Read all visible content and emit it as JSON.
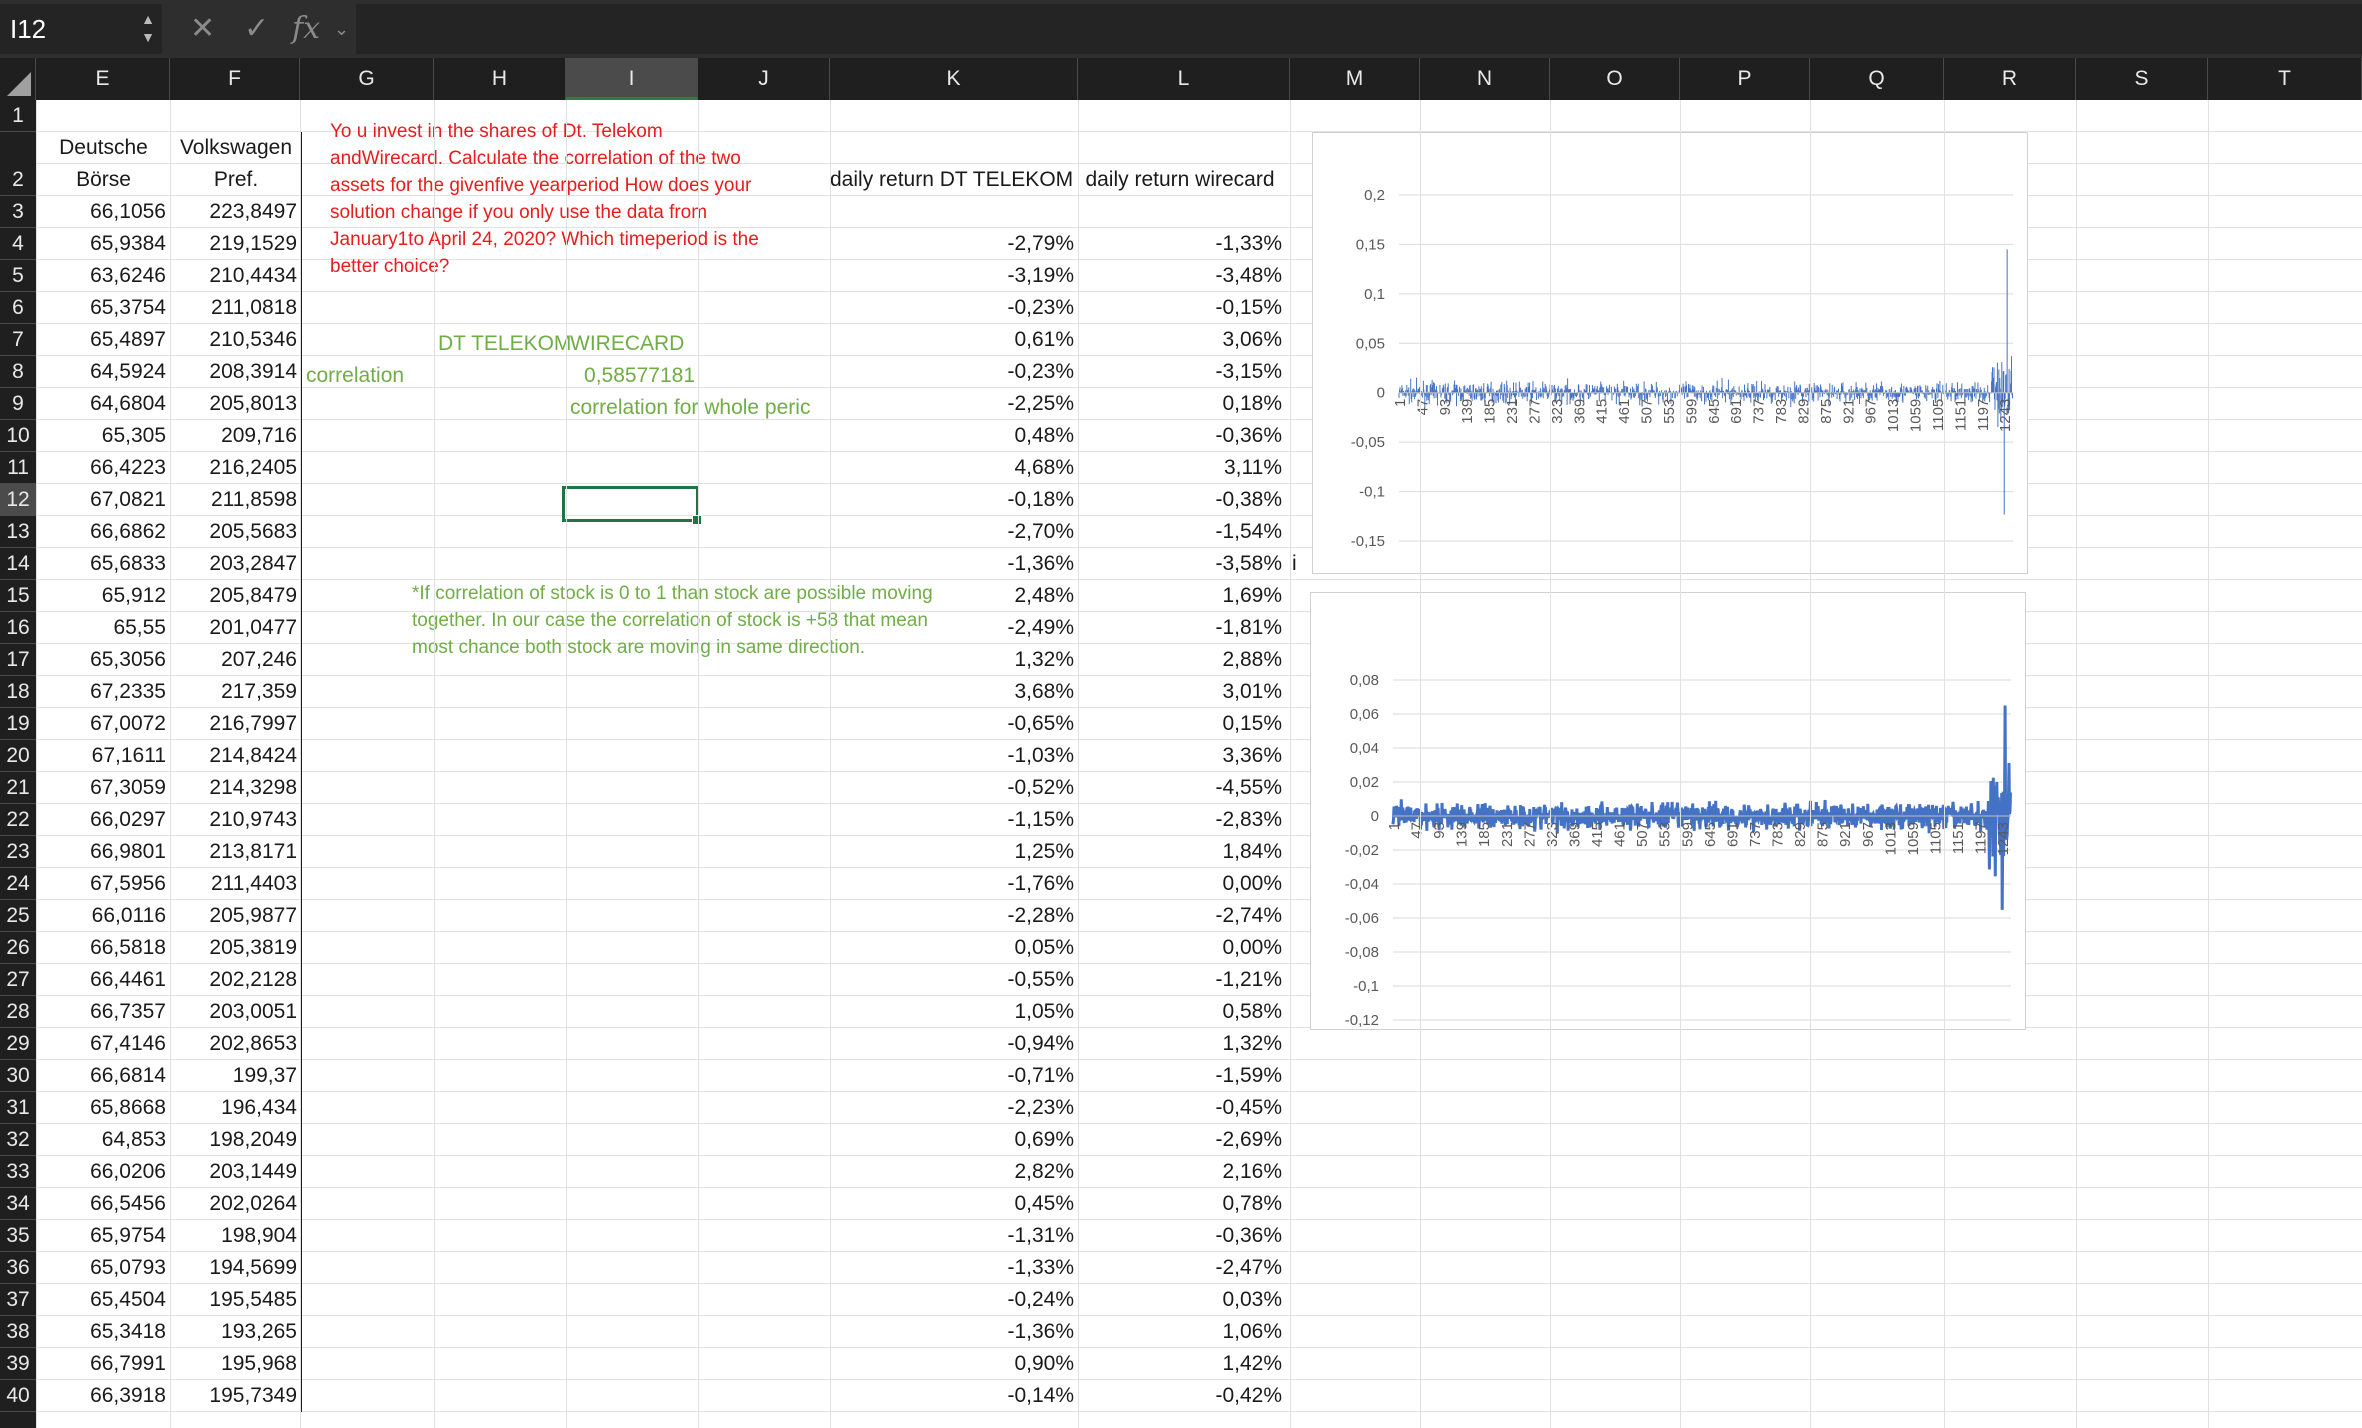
{
  "formula_bar": {
    "name_box": "I12",
    "fx_label": "fx",
    "value": ""
  },
  "columns": [
    "E",
    "F",
    "G",
    "H",
    "I",
    "J",
    "K",
    "L",
    "M",
    "N",
    "O",
    "P",
    "Q",
    "R",
    "S",
    "T"
  ],
  "rows_visible": [
    "1",
    "2",
    "3",
    "4",
    "5",
    "6",
    "7",
    "8",
    "9",
    "10",
    "11",
    "12",
    "13",
    "14",
    "15",
    "16",
    "17",
    "18",
    "19",
    "20",
    "21",
    "22",
    "23",
    "24",
    "25",
    "26",
    "27",
    "28",
    "29",
    "30",
    "31",
    "32",
    "33",
    "34",
    "35",
    "36",
    "37",
    "38",
    "39",
    "40"
  ],
  "selected": {
    "column": "I",
    "row": "12"
  },
  "headers": {
    "deutsche_line1": "Deutsche",
    "deutsche_line2": "Börse",
    "vw_line1": "Volkswagen",
    "vw_line2": "Pref.",
    "daily_telekom": "daily return DT TELEKOM",
    "daily_wirecard": "daily return wirecard"
  },
  "task_text": [
    "Yo u invest in the shares of Dt. Telekom",
    "andWirecard. Calculate the correlation of the two",
    "assets for the givenfive yearperiod How does your",
    "solution change if you only use the data from",
    "January1to April 24, 2020? Which timeperiod is the",
    "better choice?"
  ],
  "corr_labels": {
    "dt": "DT TELEKOM",
    "wc": "WIRECARD",
    "label": "correlation",
    "value": "0,58577181",
    "note": "correlation for whole peric"
  },
  "comment_text": [
    "*If correlation of stock is 0 to 1 than stock are possible moving",
    "together. In our case the correlation  of stock is +58 that mean",
    "most chance both stock are moving in same direction."
  ],
  "stray_char": "i",
  "table_rows": [
    {
      "e": "66,1056",
      "f": "223,8497",
      "k": "",
      "l": ""
    },
    {
      "e": "65,9384",
      "f": "219,1529",
      "k": "-2,79%",
      "l": "-1,33%"
    },
    {
      "e": "63,6246",
      "f": "210,4434",
      "k": "-3,19%",
      "l": "-3,48%"
    },
    {
      "e": "65,3754",
      "f": "211,0818",
      "k": "-0,23%",
      "l": "-0,15%"
    },
    {
      "e": "65,4897",
      "f": "210,5346",
      "k": "0,61%",
      "l": "3,06%"
    },
    {
      "e": "64,5924",
      "f": "208,3914",
      "k": "-0,23%",
      "l": "-3,15%"
    },
    {
      "e": "64,6804",
      "f": "205,8013",
      "k": "-2,25%",
      "l": "0,18%"
    },
    {
      "e": "65,305",
      "f": "209,716",
      "k": "0,48%",
      "l": "-0,36%"
    },
    {
      "e": "66,4223",
      "f": "216,2405",
      "k": "4,68%",
      "l": "3,11%"
    },
    {
      "e": "67,0821",
      "f": "211,8598",
      "k": "-0,18%",
      "l": "-0,38%"
    },
    {
      "e": "66,6862",
      "f": "205,5683",
      "k": "-2,70%",
      "l": "-1,54%"
    },
    {
      "e": "65,6833",
      "f": "203,2847",
      "k": "-1,36%",
      "l": "-3,58%"
    },
    {
      "e": "65,912",
      "f": "205,8479",
      "k": "2,48%",
      "l": "1,69%"
    },
    {
      "e": "65,55",
      "f": "201,0477",
      "k": "-2,49%",
      "l": "-1,81%"
    },
    {
      "e": "65,3056",
      "f": "207,246",
      "k": "1,32%",
      "l": "2,88%"
    },
    {
      "e": "67,2335",
      "f": "217,359",
      "k": "3,68%",
      "l": "3,01%"
    },
    {
      "e": "67,0072",
      "f": "216,7997",
      "k": "-0,65%",
      "l": "0,15%"
    },
    {
      "e": "67,1611",
      "f": "214,8424",
      "k": "-1,03%",
      "l": "3,36%"
    },
    {
      "e": "67,3059",
      "f": "214,3298",
      "k": "-0,52%",
      "l": "-4,55%"
    },
    {
      "e": "66,0297",
      "f": "210,9743",
      "k": "-1,15%",
      "l": "-2,83%"
    },
    {
      "e": "66,9801",
      "f": "213,8171",
      "k": "1,25%",
      "l": "1,84%"
    },
    {
      "e": "67,5956",
      "f": "211,4403",
      "k": "-1,76%",
      "l": "0,00%"
    },
    {
      "e": "66,0116",
      "f": "205,9877",
      "k": "-2,28%",
      "l": "-2,74%"
    },
    {
      "e": "66,5818",
      "f": "205,3819",
      "k": "0,05%",
      "l": "0,00%"
    },
    {
      "e": "66,4461",
      "f": "202,2128",
      "k": "-0,55%",
      "l": "-1,21%"
    },
    {
      "e": "66,7357",
      "f": "203,0051",
      "k": "1,05%",
      "l": "0,58%"
    },
    {
      "e": "67,4146",
      "f": "202,8653",
      "k": "-0,94%",
      "l": "1,32%"
    },
    {
      "e": "66,6814",
      "f": "199,37",
      "k": "-0,71%",
      "l": "-1,59%"
    },
    {
      "e": "65,8668",
      "f": "196,434",
      "k": "-2,23%",
      "l": "-0,45%"
    },
    {
      "e": "64,853",
      "f": "198,2049",
      "k": "0,69%",
      "l": "-2,69%"
    },
    {
      "e": "66,0206",
      "f": "203,1449",
      "k": "2,82%",
      "l": "2,16%"
    },
    {
      "e": "66,5456",
      "f": "202,0264",
      "k": "0,45%",
      "l": "0,78%"
    },
    {
      "e": "65,9754",
      "f": "198,904",
      "k": "-1,31%",
      "l": "-0,36%"
    },
    {
      "e": "65,0793",
      "f": "194,5699",
      "k": "-1,33%",
      "l": "-2,47%"
    },
    {
      "e": "65,4504",
      "f": "195,5485",
      "k": "-0,24%",
      "l": "0,03%"
    },
    {
      "e": "65,3418",
      "f": "193,265",
      "k": "-1,36%",
      "l": "1,06%"
    },
    {
      "e": "66,7991",
      "f": "195,968",
      "k": "0,90%",
      "l": "1,42%"
    },
    {
      "e": "66,3918",
      "f": "195,7349",
      "k": "-0,14%",
      "l": "-0,42%"
    }
  ],
  "chart_data": [
    {
      "type": "bar",
      "ylim": [
        -0.15,
        0.2
      ],
      "y_ticks": [
        "0,2",
        "0,15",
        "0,1",
        "0,05",
        "0",
        "-0,05",
        "-0,1",
        "-0,15"
      ],
      "x_ticks": [
        "1",
        "47",
        "93",
        "139",
        "185",
        "231",
        "277",
        "323",
        "369",
        "415",
        "461",
        "507",
        "553",
        "599",
        "645",
        "691",
        "737",
        "783",
        "829",
        "875",
        "921",
        "967",
        "1013",
        "1059",
        "1105",
        "1151",
        "1197",
        "1243"
      ],
      "color": "#4472c4",
      "n_points": 1260
    },
    {
      "type": "line",
      "ylim": [
        -0.12,
        0.08
      ],
      "y_ticks": [
        "0,08",
        "0,06",
        "0,04",
        "0,02",
        "0",
        "-0,02",
        "-0,04",
        "-0,06",
        "-0,08",
        "-0,1",
        "-0,12"
      ],
      "x_ticks": [
        "1",
        "47",
        "93",
        "139",
        "185",
        "231",
        "277",
        "323",
        "369",
        "415",
        "461",
        "507",
        "553",
        "599",
        "645",
        "691",
        "737",
        "783",
        "829",
        "875",
        "921",
        "967",
        "1013",
        "1059",
        "1105",
        "1151",
        "1197",
        "1243"
      ],
      "color": "#4472c4",
      "n_points": 1260
    }
  ]
}
